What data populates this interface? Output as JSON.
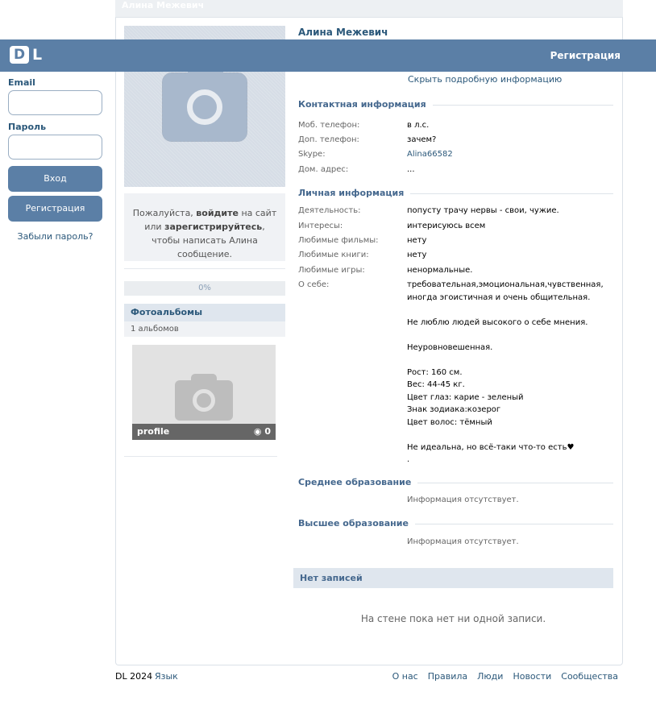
{
  "card_head": "Алина Межевич",
  "header": {
    "logo_d": "D",
    "logo_l": "L",
    "register_link": "Регистрация"
  },
  "login": {
    "email_label": "Email",
    "password_label": "Пароль",
    "login_button": "Вход",
    "register_button": "Регистрация",
    "forgot_link": "Забыли пароль?"
  },
  "guest": {
    "part1": "Пожалуйста, ",
    "login": "войдите",
    "part2": " на сайт или ",
    "register": "зарегистрируйтесь",
    "part3": ", чтобы написать Алина сообщение."
  },
  "progress": {
    "text": "0%",
    "value_percent": 0
  },
  "albums": {
    "title": "Фотоальбомы",
    "count": "1 альбомов",
    "album_name": "profile",
    "album_photos": "0"
  },
  "profile": {
    "name": "Алина Межевич",
    "hide_info": "Скрыть подробную информацию"
  },
  "contact": {
    "title": "Контактная информация",
    "rows": [
      {
        "k": "Моб. телефон:",
        "v": "в л.с."
      },
      {
        "k": "Доп. телефон:",
        "v": "зачем?"
      },
      {
        "k": "Skype:",
        "v": "Alina66582"
      },
      {
        "k": "Дом. адрес:",
        "v": "..."
      }
    ]
  },
  "personal": {
    "title": "Личная информация",
    "rows": [
      {
        "k": "Деятельность:",
        "v": "попусту трачу нервы - свои, чужие."
      },
      {
        "k": "Интересы:",
        "v": "интерисуюсь всем"
      },
      {
        "k": "Любимые фильмы:",
        "v": "нету"
      },
      {
        "k": "Любимые книги:",
        "v": "нету"
      },
      {
        "k": "Любимые игры:",
        "v": "ненормальные."
      },
      {
        "k": "О себе:",
        "v": "требовательная,эмоциональная,чувственная, иногда эгоистичная и очень общительная.\n\nНе люблю людей высокого о себе мнения.\n\nНеуровновешенная.\n\nРост: 160 см.\nВес: 44-45 кг.\nЦвет глаз: карие - зеленый\nЗнак зодиака:козерог\nЦвет волос: тёмный\n\nНе идеальна, но всё-таки что-то есть♥\n."
      }
    ]
  },
  "secondary_edu": {
    "title": "Среднее образование",
    "value": "Информация отсутствует."
  },
  "higher_edu": {
    "title": "Высшее образование",
    "value": "Информация отсутствует."
  },
  "wall": {
    "title": "Нет записей",
    "empty": "На стене пока нет ни одной записи."
  },
  "footer": {
    "copy": "DL 2024",
    "lang": "Язык",
    "links": [
      "О нас",
      "Правила",
      "Люди",
      "Новости",
      "Сообщества"
    ]
  }
}
